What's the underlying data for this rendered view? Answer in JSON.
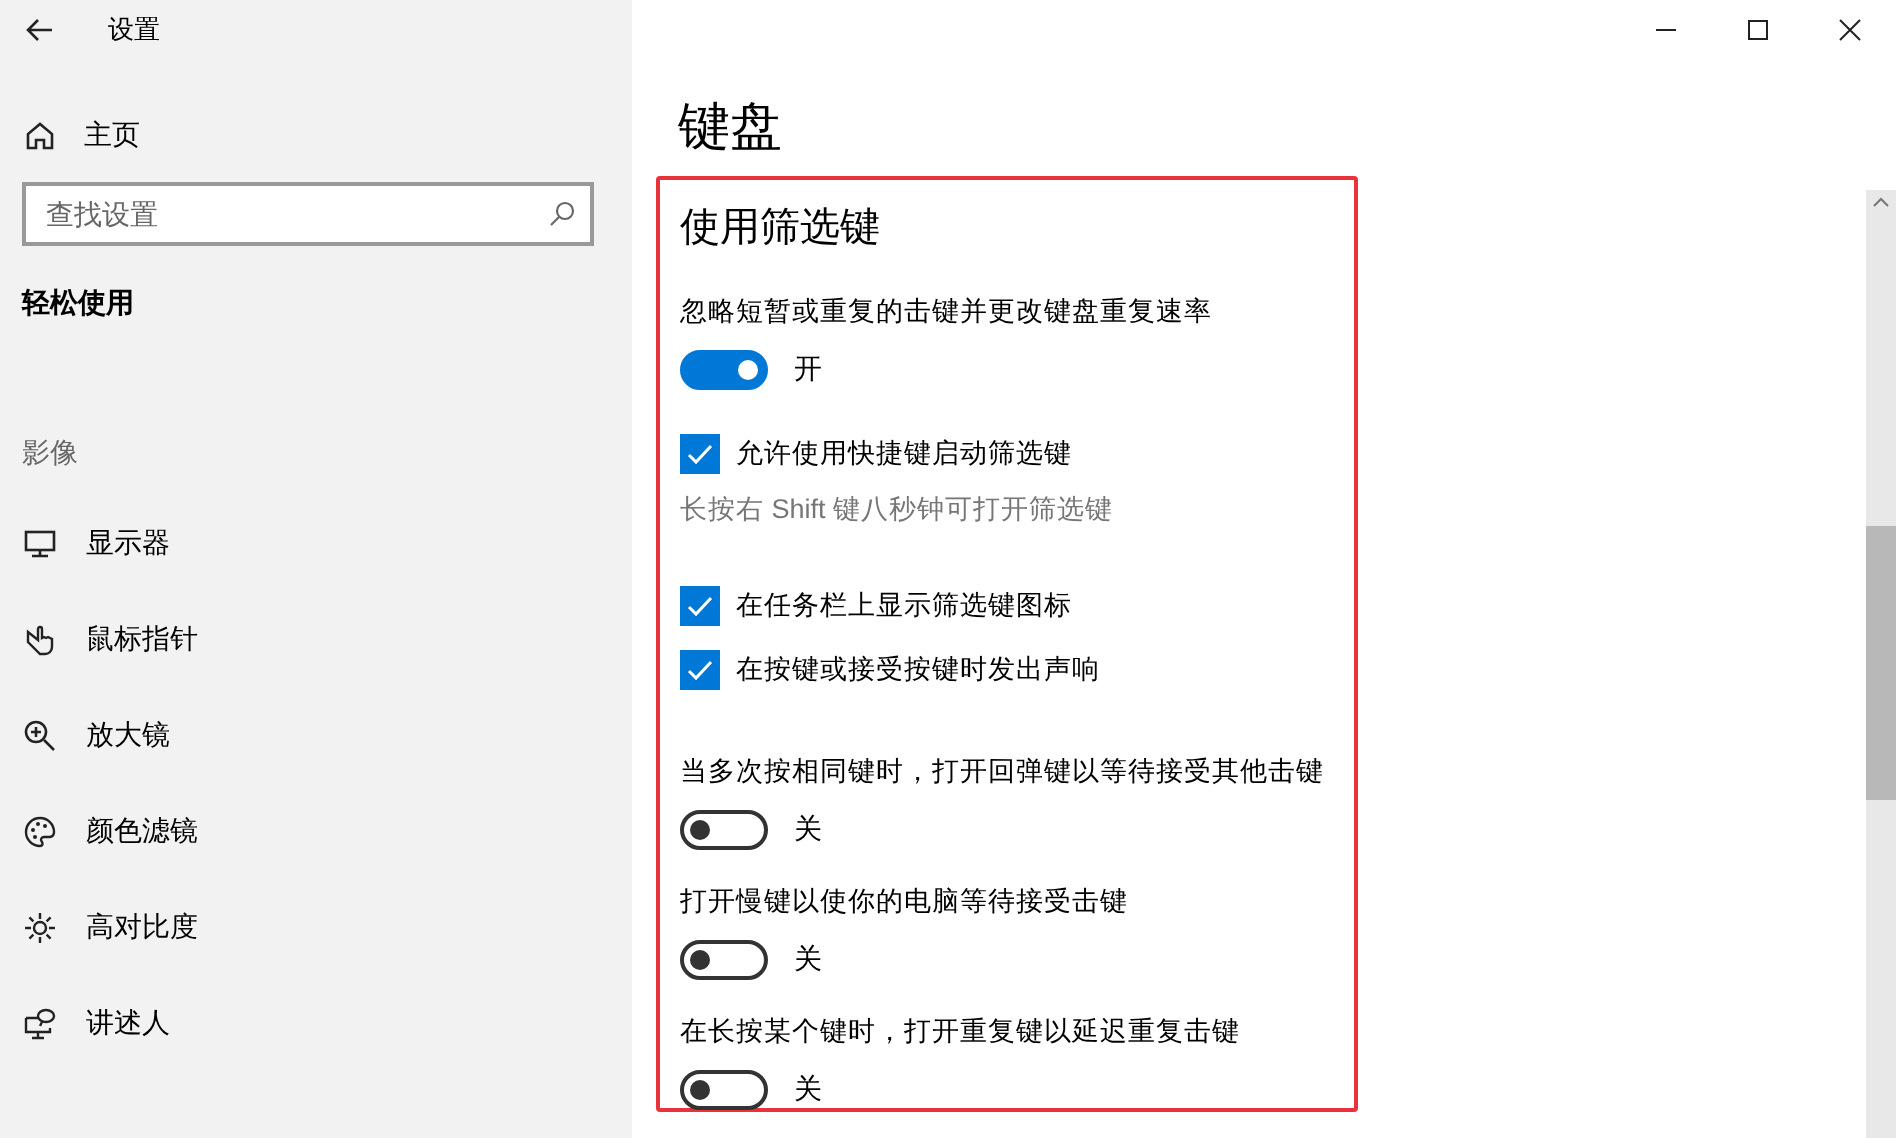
{
  "sidebar": {
    "title": "设置",
    "home": "主页",
    "search": {
      "placeholder": "查找设置"
    },
    "section": "轻松使用",
    "group": "影像",
    "items": [
      {
        "label": "显示器"
      },
      {
        "label": "鼠标指针"
      },
      {
        "label": "放大镜"
      },
      {
        "label": "颜色滤镜"
      },
      {
        "label": "高对比度"
      },
      {
        "label": "讲述人"
      }
    ]
  },
  "content": {
    "title": "键盘",
    "section": {
      "heading": "使用筛选键",
      "items": [
        {
          "kind": "label",
          "text": "忽略短暂或重复的击键并更改键盘重复速率"
        },
        {
          "kind": "toggle",
          "on": true,
          "text": "开"
        },
        {
          "kind": "checkbox",
          "checked": true,
          "text": "允许使用快捷键启动筛选键"
        },
        {
          "kind": "note",
          "text": "长按右 Shift 键八秒钟可打开筛选键"
        },
        {
          "kind": "checkbox",
          "checked": true,
          "text": "在任务栏上显示筛选键图标"
        },
        {
          "kind": "checkbox",
          "checked": true,
          "text": "在按键或接受按键时发出声响"
        },
        {
          "kind": "label",
          "text": "当多次按相同键时，打开回弹键以等待接受其他击键"
        },
        {
          "kind": "toggle",
          "on": false,
          "text": "关"
        },
        {
          "kind": "label",
          "text": "打开慢键以使你的电脑等待接受击键"
        },
        {
          "kind": "toggle",
          "on": false,
          "text": "关"
        },
        {
          "kind": "label",
          "text": "在长按某个键时，打开重复键以延迟重复击键"
        },
        {
          "kind": "toggle",
          "on": false,
          "text": "关"
        }
      ]
    }
  }
}
